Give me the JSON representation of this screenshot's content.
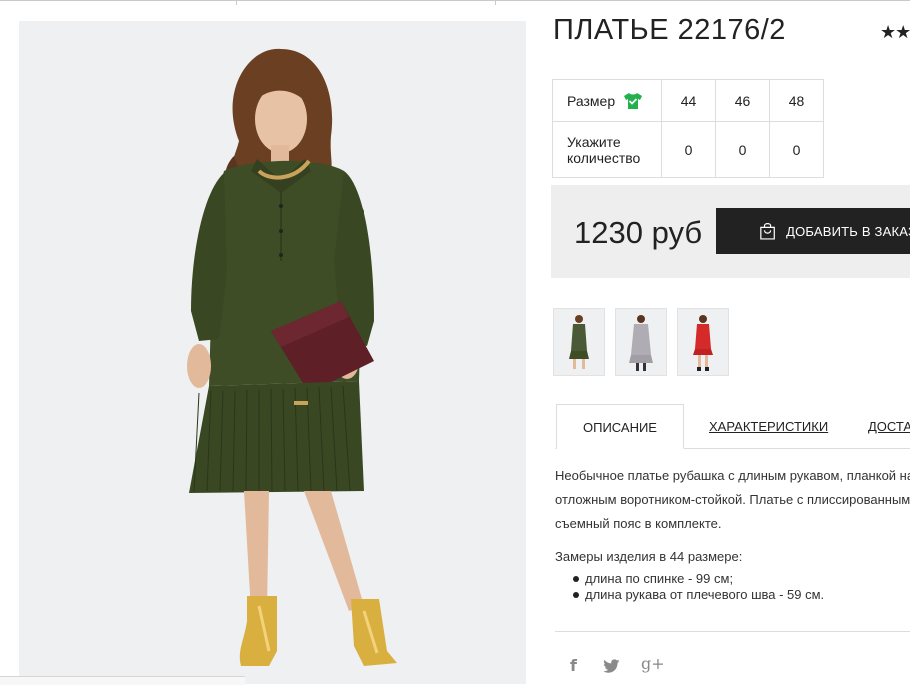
{
  "product": {
    "title": "ПЛАТЬЕ 22176/2",
    "rating_stars": "★★"
  },
  "sizes": {
    "size_label": "Размер",
    "qty_label_line1": "Укажите",
    "qty_label_line2": "количество",
    "columns": [
      "44",
      "46",
      "48"
    ],
    "quantities": [
      "0",
      "0",
      "0"
    ],
    "size_icon_color": "#22b14c"
  },
  "price": {
    "value": "1230 руб",
    "button_label": "ДОБАВИТЬ В ЗАКАЗ"
  },
  "thumbnails": [
    {
      "icon": "green-dress-thumb",
      "color": "#4b5a36"
    },
    {
      "icon": "gray-dress-thumb",
      "color": "#b0acb4"
    },
    {
      "icon": "red-dress-thumb",
      "color": "#d42a2a"
    }
  ],
  "tabs": [
    "ОПИСАНИЕ",
    "ХАРАКТЕРИСТИКИ",
    "ДОСТАВКА"
  ],
  "description": {
    "line1": "Необычное платье рубашка с длиным рукавом, планкой на",
    "line2": "отложным воротником-стойкой. Платье с плиссированным",
    "line3": "съемный пояс в комплекте.",
    "measures_title": "Замеры изделия в 44 размере:",
    "measures": [
      "длина по спинке - 99 см;",
      "длина рукава от плечевого шва - 59 см."
    ]
  },
  "social": {
    "facebook": "f",
    "twitter": "twitter-icon",
    "googleplus": "g+"
  },
  "colors": {
    "dress": "#3f4d26",
    "dress_dark": "#2f3a1c",
    "clutch": "#5e1f26",
    "boots": "#d9b040",
    "skin": "#e8c2a5",
    "hair": "#5a3520",
    "photo_bg": "#eef0f1"
  }
}
